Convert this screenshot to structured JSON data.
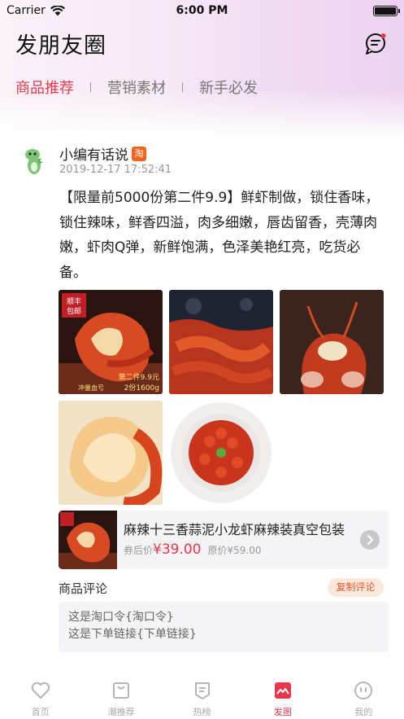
{
  "status_bar": {
    "carrier": "Carrier",
    "time": "6:00 PM"
  },
  "header": {
    "title": "发朋友圈"
  },
  "tabs": [
    {
      "label": "商品推荐",
      "active": true
    },
    {
      "label": "营销素材",
      "active": false
    },
    {
      "label": "新手必发",
      "active": false
    }
  ],
  "post": {
    "author": "小编有话说",
    "author_badge": "淘",
    "time": "2019-12-17 17:52:41",
    "text": "【限量前5000份第二件9.9】鲜虾制做，锁住香味，锁住辣味，鲜香四溢，肉多细嫩，唇齿留香，壳薄肉嫩，虾肉Q弹，新鲜饱满，色泽美艳红亮，吃货必备。",
    "image_labels": {
      "badge": "顺丰\n包邮",
      "promo": "第二件9.9元",
      "spec": "2份1600g",
      "note": "冲量血亏"
    }
  },
  "product": {
    "name": "麻辣十三香蒜泥小龙虾麻辣装真空包装",
    "coupon_label": "券后价",
    "price": "¥39.00",
    "original_label": "原价",
    "original_price": "¥59.00"
  },
  "comments": {
    "title": "商品评论",
    "copy_button": "复制评论",
    "line1": "这是淘口令{淘口令}",
    "line2": "这是下单链接{下单链接}"
  },
  "tab_bar": [
    {
      "label": "首页",
      "icon": "heart-icon",
      "active": false
    },
    {
      "label": "潮推荐",
      "icon": "bag-icon",
      "active": false
    },
    {
      "label": "热榜",
      "icon": "list-icon",
      "active": false
    },
    {
      "label": "发图",
      "icon": "image-icon",
      "active": true
    },
    {
      "label": "我的",
      "icon": "face-icon",
      "active": false
    }
  ],
  "colors": {
    "accent": "#e8374c",
    "price": "#e8374c",
    "copy_bg": "#fde9dc"
  }
}
